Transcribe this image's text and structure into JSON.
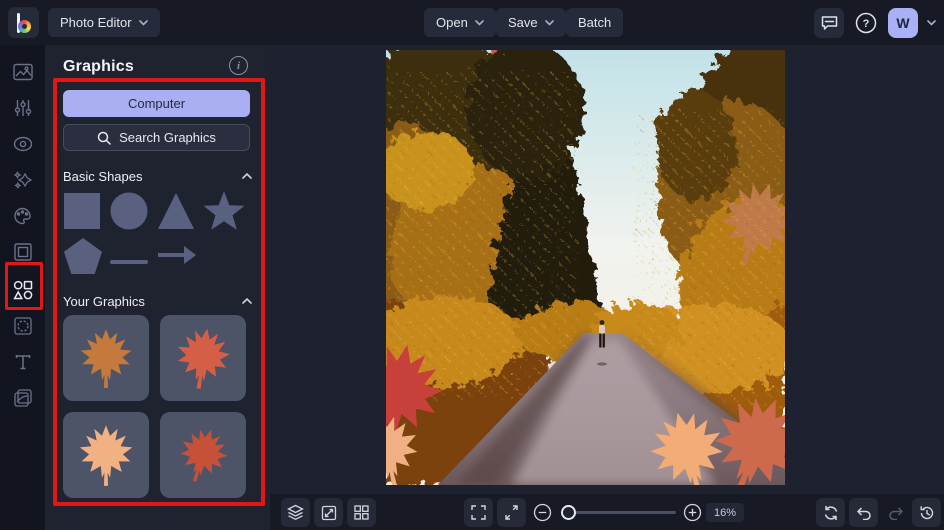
{
  "app": {
    "logo_letter": "b",
    "mode_selector": "Photo Editor"
  },
  "topbar": {
    "open_label": "Open",
    "save_label": "Save",
    "batch_label": "Batch",
    "feedback_icon": "chat-bubble-icon",
    "help_icon": "question-circle-icon",
    "help_glyph": "?",
    "avatar_initial": "W"
  },
  "sidebar": {
    "icons": [
      "edit-photo-icon",
      "adjust-icon",
      "touch-up-icon",
      "effects-icon",
      "artsy-icon",
      "frames-icon",
      "graphics-icon",
      "overlays-icon",
      "text-icon",
      "textures-icon"
    ],
    "active_icon": "graphics-icon"
  },
  "panel": {
    "title": "Graphics",
    "info_icon": "info-circle-icon",
    "info_glyph": "i",
    "computer_button": "Computer",
    "search_button": "Search Graphics",
    "basic_shapes": {
      "label": "Basic Shapes",
      "shapes": [
        "square",
        "circle",
        "triangle",
        "star",
        "pentagon",
        "line",
        "arrow"
      ],
      "shape_color": "#5a6180"
    },
    "your_graphics": {
      "label": "Your Graphics",
      "items": [
        {
          "name": "maple-leaf-orange-brown",
          "color": "#c4793d"
        },
        {
          "name": "maple-leaf-red-orange",
          "color": "#d55f46"
        },
        {
          "name": "maple-leaf-light-peach",
          "color": "#f2b183"
        },
        {
          "name": "maple-leaf-dark-red",
          "color": "#c65038"
        }
      ]
    }
  },
  "bottombar": {
    "left_icons": [
      "layers-icon",
      "resize-icon",
      "collage-grid-icon"
    ],
    "view_icons": [
      "fullscreen-icon",
      "fit-screen-icon"
    ],
    "zoom_out_icon": "zoom-out-icon",
    "zoom_in_icon": "zoom-in-icon",
    "zoom_level": "16%",
    "right_icons": [
      "refresh-icon",
      "undo-icon",
      "redo-icon",
      "history-icon"
    ]
  },
  "colors": {
    "accent_lavender": "#a9aff2",
    "highlight_red": "#e41717",
    "panel_bg": "#1f2330",
    "topbar_bg": "#171a24",
    "tile_bg": "#262b3b",
    "thumb_bg": "#4e5468"
  }
}
